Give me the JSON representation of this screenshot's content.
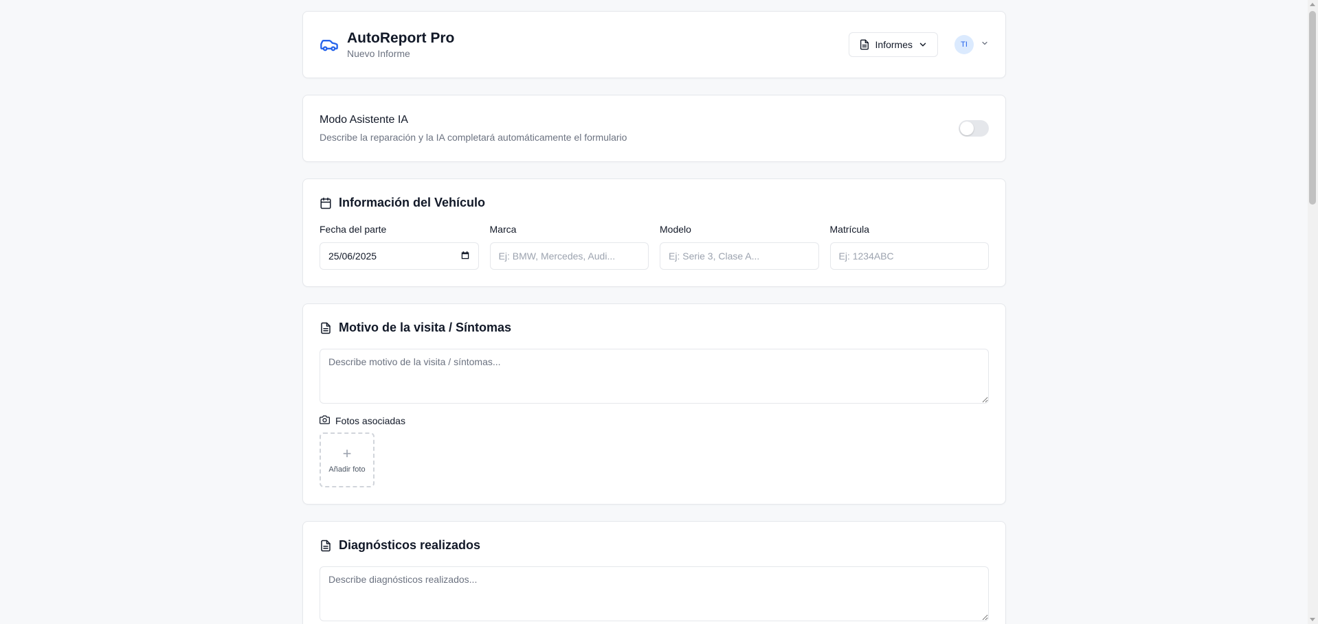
{
  "header": {
    "title": "AutoReport Pro",
    "subtitle": "Nuevo Informe",
    "reports_label": "Informes",
    "avatar_initials": "TI",
    "brand_icon": "car-icon",
    "accent_color": "#2563eb"
  },
  "ai_mode": {
    "title": "Modo Asistente IA",
    "description": "Describe la reparación y la IA completará automáticamente el formulario",
    "enabled": false
  },
  "vehicle": {
    "title": "Información del Vehículo",
    "fields": [
      {
        "label": "Fecha del parte",
        "value": "25/06/2025",
        "placeholder": ""
      },
      {
        "label": "Marca",
        "value": "",
        "placeholder": "Ej: BMW, Mercedes, Audi..."
      },
      {
        "label": "Modelo",
        "value": "",
        "placeholder": "Ej: Serie 3, Clase A..."
      },
      {
        "label": "Matrícula",
        "value": "",
        "placeholder": "Ej: 1234ABC"
      }
    ]
  },
  "visit": {
    "title": "Motivo de la visita / Síntomas",
    "placeholder": "Describe motivo de la visita / síntomas...",
    "photos_label": "Fotos asociadas",
    "add_photo_label": "Añadir foto"
  },
  "diagnostics": {
    "title": "Diagnósticos realizados",
    "placeholder": "Describe diagnósticos realizados..."
  }
}
